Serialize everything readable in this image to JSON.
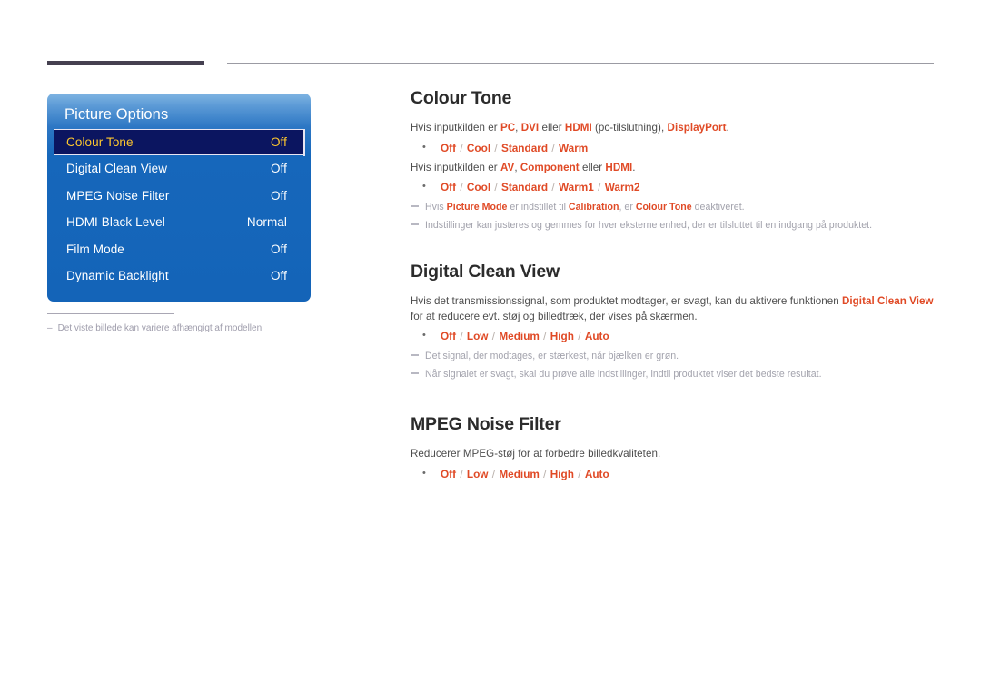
{
  "page": {
    "language": "da",
    "accent_color": "#e04a26",
    "panel_blue": "#1464b8",
    "panel_selected_bg": "#0b1560",
    "panel_selected_text": "#ffc82e",
    "rule_dark_color": "#454050",
    "rule_thin_color": "#9b9ba3"
  },
  "osd": {
    "title": "Picture Options",
    "rows": [
      {
        "label": "Colour Tone",
        "value": "Off",
        "selected": true
      },
      {
        "label": "Digital Clean View",
        "value": "Off",
        "selected": false
      },
      {
        "label": "MPEG Noise Filter",
        "value": "Off",
        "selected": false
      },
      {
        "label": "HDMI Black Level",
        "value": "Normal",
        "selected": false
      },
      {
        "label": "Film Mode",
        "value": "Off",
        "selected": false
      },
      {
        "label": "Dynamic Backlight",
        "value": "Off",
        "selected": false
      }
    ],
    "caption_dash": "–",
    "caption": "Det viste billede kan variere afhængigt af modellen."
  },
  "sections": {
    "colour_tone": {
      "heading": "Colour Tone",
      "para1": {
        "t1": "Hvis inputkilden er ",
        "h1": "PC",
        "t2": ", ",
        "h2": "DVI",
        "t3": " eller ",
        "h3": "HDMI",
        "t4": " (pc-tilslutning), ",
        "h4": "DisplayPort",
        "t5": "."
      },
      "opts1": [
        "Off",
        "Cool",
        "Standard",
        "Warm"
      ],
      "para2": {
        "t1": "Hvis inputkilden er ",
        "h1": "AV",
        "t2": ", ",
        "h2": "Component",
        "t3": " eller ",
        "h3": "HDMI",
        "t4": "."
      },
      "opts2": [
        "Off",
        "Cool",
        "Standard",
        "Warm1",
        "Warm2"
      ],
      "note1": {
        "t1": "Hvis ",
        "h1": "Picture Mode",
        "t2": " er indstillet til ",
        "h2": "Calibration",
        "t3": ", er ",
        "h3": "Colour Tone",
        "t4": " deaktiveret."
      },
      "note2": "Indstillinger kan justeres og gemmes for hver eksterne enhed, der er tilsluttet til en indgang på produktet."
    },
    "digital_clean_view": {
      "heading": "Digital Clean View",
      "para1": {
        "t1": "Hvis det transmissionssignal, som produktet modtager, er svagt, kan du aktivere funktionen ",
        "h1": "Digital Clean View",
        "t2": " for at reducere evt. støj og billedtræk, der vises på skærmen."
      },
      "opts1": [
        "Off",
        "Low",
        "Medium",
        "High",
        "Auto"
      ],
      "note1": "Det signal, der modtages, er stærkest, når bjælken er grøn.",
      "note2": "Når signalet er svagt, skal du prøve alle indstillinger, indtil produktet viser det bedste resultat."
    },
    "mpeg_noise_filter": {
      "heading": "MPEG Noise Filter",
      "para1": "Reducerer MPEG-støj for at forbedre billedkvaliteten.",
      "opts1": [
        "Off",
        "Low",
        "Medium",
        "High",
        "Auto"
      ]
    }
  }
}
